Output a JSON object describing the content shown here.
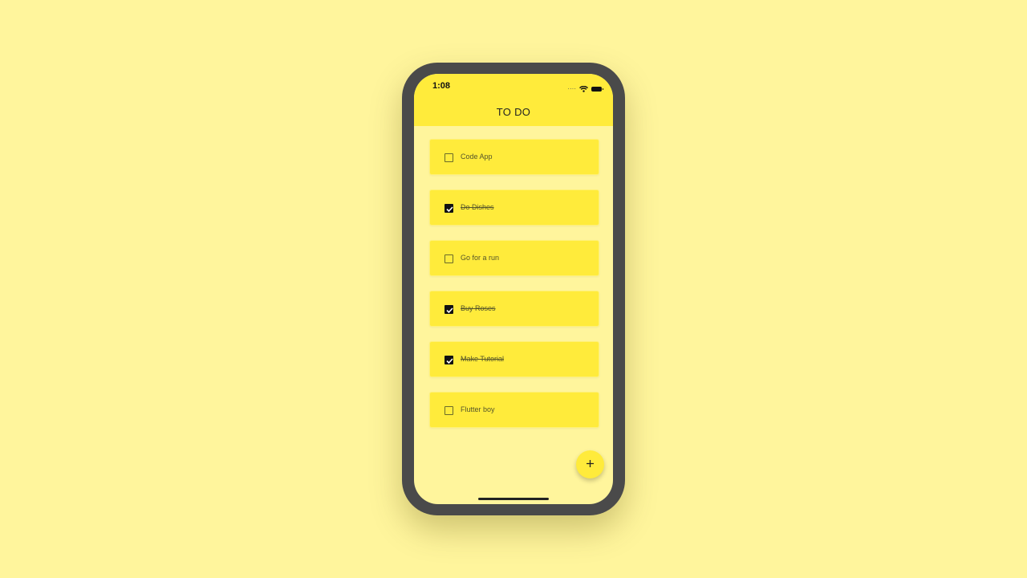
{
  "status_bar": {
    "time": "1:08",
    "signal_icon": "signal-dots-icon",
    "wifi_icon": "wifi-icon",
    "battery_icon": "battery-icon"
  },
  "app_bar": {
    "title": "TO DO",
    "background_color": "#ffeb3b"
  },
  "todos": [
    {
      "label": "Code App",
      "done": false
    },
    {
      "label": "Do Dishes",
      "done": true
    },
    {
      "label": "Go for a run",
      "done": false
    },
    {
      "label": "Buy Roses",
      "done": true
    },
    {
      "label": "Make Tutorial",
      "done": true
    },
    {
      "label": "Flutter boy",
      "done": false
    }
  ],
  "fab": {
    "icon": "plus-icon",
    "symbol": "+"
  },
  "colors": {
    "page_background": "#fff59c",
    "accent": "#ffeb3b",
    "phone_frame": "#4a4a4a"
  }
}
